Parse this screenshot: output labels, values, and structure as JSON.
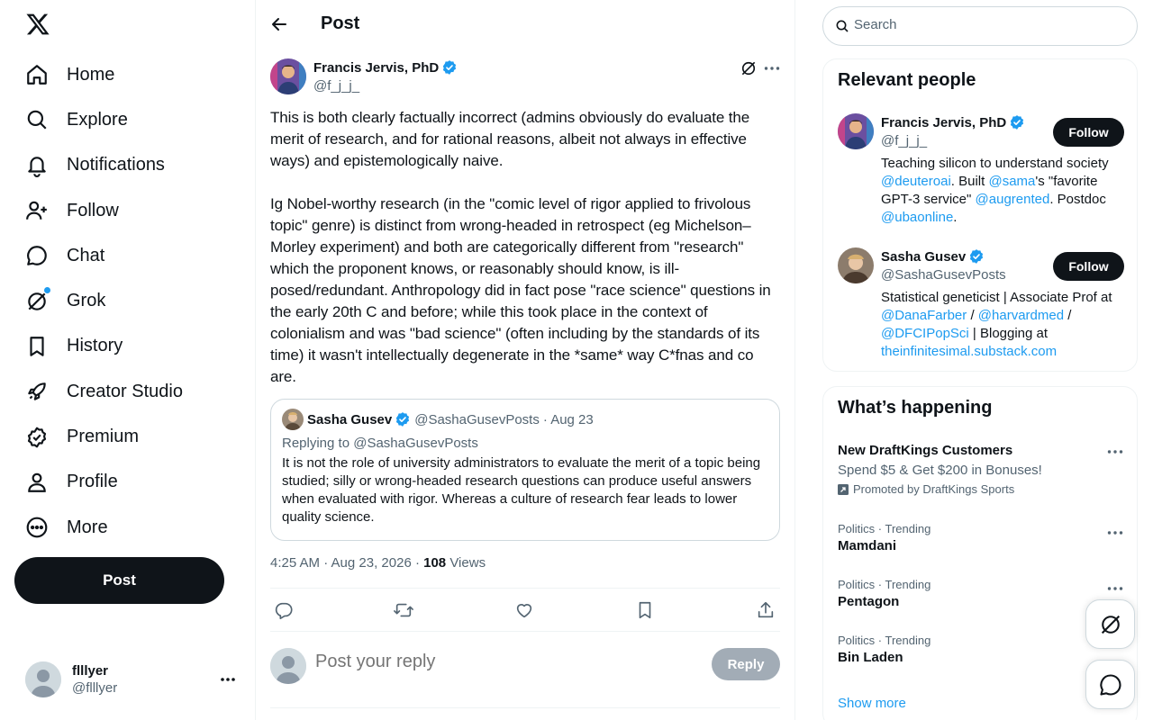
{
  "colors": {
    "accent": "#1d9bf0",
    "text": "#0f1419",
    "muted": "#536471"
  },
  "nav": {
    "items": [
      {
        "label": "Home",
        "icon": "home-icon"
      },
      {
        "label": "Explore",
        "icon": "search-icon"
      },
      {
        "label": "Notifications",
        "icon": "bell-icon"
      },
      {
        "label": "Follow",
        "icon": "person-add-icon"
      },
      {
        "label": "Chat",
        "icon": "chat-bubble-icon"
      },
      {
        "label": "Grok",
        "icon": "grok-icon"
      },
      {
        "label": "History",
        "icon": "bookmark-icon"
      },
      {
        "label": "Creator Studio",
        "icon": "rocket-icon"
      },
      {
        "label": "Premium",
        "icon": "verified-badge-icon"
      },
      {
        "label": "Profile",
        "icon": "person-icon"
      },
      {
        "label": "More",
        "icon": "more-circle-icon"
      }
    ],
    "post_label": "Post"
  },
  "account": {
    "display_name": "flllyer",
    "handle": "@flllyer"
  },
  "header": {
    "title": "Post"
  },
  "tweet": {
    "author_name": "Francis Jervis, PhD",
    "author_handle": "@f_j_j_",
    "body": "This is both clearly factually incorrect (admins obviously do evaluate the merit of research, and for rational reasons, albeit not always in effective ways) and epistemologically naive.\n\nIg Nobel-worthy research (in the \"comic level of rigor applied to frivolous topic\" genre) is distinct from wrong-headed in retrospect (eg Michelson–Morley experiment) and both are categorically different from \"research\" which the proponent knows, or reasonably should know, is ill-posed/redundant. Anthropology did in fact pose \"race science\" questions in the early 20th C and before; while this took place in the context of colonialism and was \"bad science\" (often including by the standards of its time) it wasn't intellectually degenerate in the *same* way C*fnas and co are.",
    "time": "4:25 AM · Aug 23, 2026 · ",
    "views_count": "108",
    "views_label": " Views"
  },
  "quote": {
    "author_name": "Sasha Gusev",
    "author_handle": "@SashaGusevPosts",
    "date": "· Aug 23",
    "replying_to": "Replying to @SashaGusevPosts",
    "body": "It is not the role of university administrators to evaluate the merit of a topic being studied; silly or wrong-headed research questions can produce useful answers when evaluated with rigor. Whereas a culture of research fear leads to lower quality science."
  },
  "reply": {
    "placeholder": "Post your reply",
    "button": "Reply"
  },
  "search": {
    "placeholder": "Search"
  },
  "relevant": {
    "title": "Relevant people",
    "people": [
      {
        "name": "Francis Jervis, PhD",
        "handle": "@f_j_j_",
        "follow": "Follow",
        "bio": {
          "t1": "Teaching silicon to understand society ",
          "m1": "@deuteroai",
          "t2": ". Built ",
          "m2": "@sama",
          "t3": "'s \"favorite GPT-3 service\" ",
          "m3": "@augrented",
          "t4": ". Postdoc ",
          "m4": "@ubaonline",
          "t5": "."
        }
      },
      {
        "name": "Sasha Gusev",
        "handle": "@SashaGusevPosts",
        "follow": "Follow",
        "bio": {
          "t1": "Statistical geneticist | Associate Prof at ",
          "m1": "@DanaFarber",
          "t2": " / ",
          "m2": "@harvardmed",
          "t3": " / ",
          "m3": "@DFCIPopSci",
          "t4": " | Blogging at ",
          "m4": "theinfinitesimal.substack.com",
          "t5": ""
        }
      }
    ]
  },
  "trending": {
    "title": "What’s happening",
    "promo": {
      "name": "New DraftKings Customers",
      "sub": "Spend $5 & Get $200 in Bonuses!",
      "promoted": "Promoted by DraftKings Sports"
    },
    "items": [
      {
        "category": "Politics · Trending",
        "name": "Mamdani"
      },
      {
        "category": "Politics · Trending",
        "name": "Pentagon"
      },
      {
        "category": "Politics · Trending",
        "name": "Bin Laden"
      }
    ],
    "show_more": "Show more"
  }
}
